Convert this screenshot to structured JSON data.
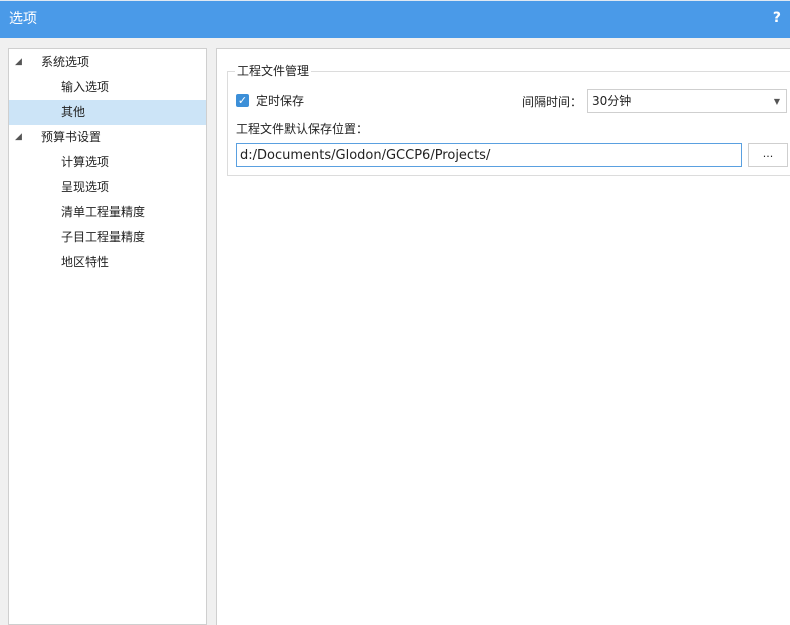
{
  "window": {
    "title": "选项",
    "help_label": "?"
  },
  "tree": {
    "items": [
      {
        "label": "系统选项",
        "expander": "◢"
      },
      {
        "label": "输入选项"
      },
      {
        "label": "其他",
        "selected": true
      },
      {
        "label": "预算书设置",
        "expander": "◢"
      },
      {
        "label": "计算选项"
      },
      {
        "label": "呈现选项"
      },
      {
        "label": "清单工程量精度"
      },
      {
        "label": "子目工程量精度"
      },
      {
        "label": "地区特性"
      }
    ]
  },
  "content": {
    "group_title": "工程文件管理",
    "autosave": {
      "checked": true,
      "check_glyph": "✓",
      "label": "定时保存"
    },
    "interval": {
      "label": "间隔时间：",
      "value": "30分钟",
      "arrow": "▼"
    },
    "path": {
      "label": "工程文件默认保存位置：",
      "value": "d:/Documents/Glodon/GCCP6/Projects/"
    },
    "browse_label": "..."
  },
  "colors": {
    "titlebar": "#4a9ae8",
    "selected_row": "#cce4f7",
    "checkbox": "#3c8fd8",
    "focus_border": "#5aa0e0"
  }
}
